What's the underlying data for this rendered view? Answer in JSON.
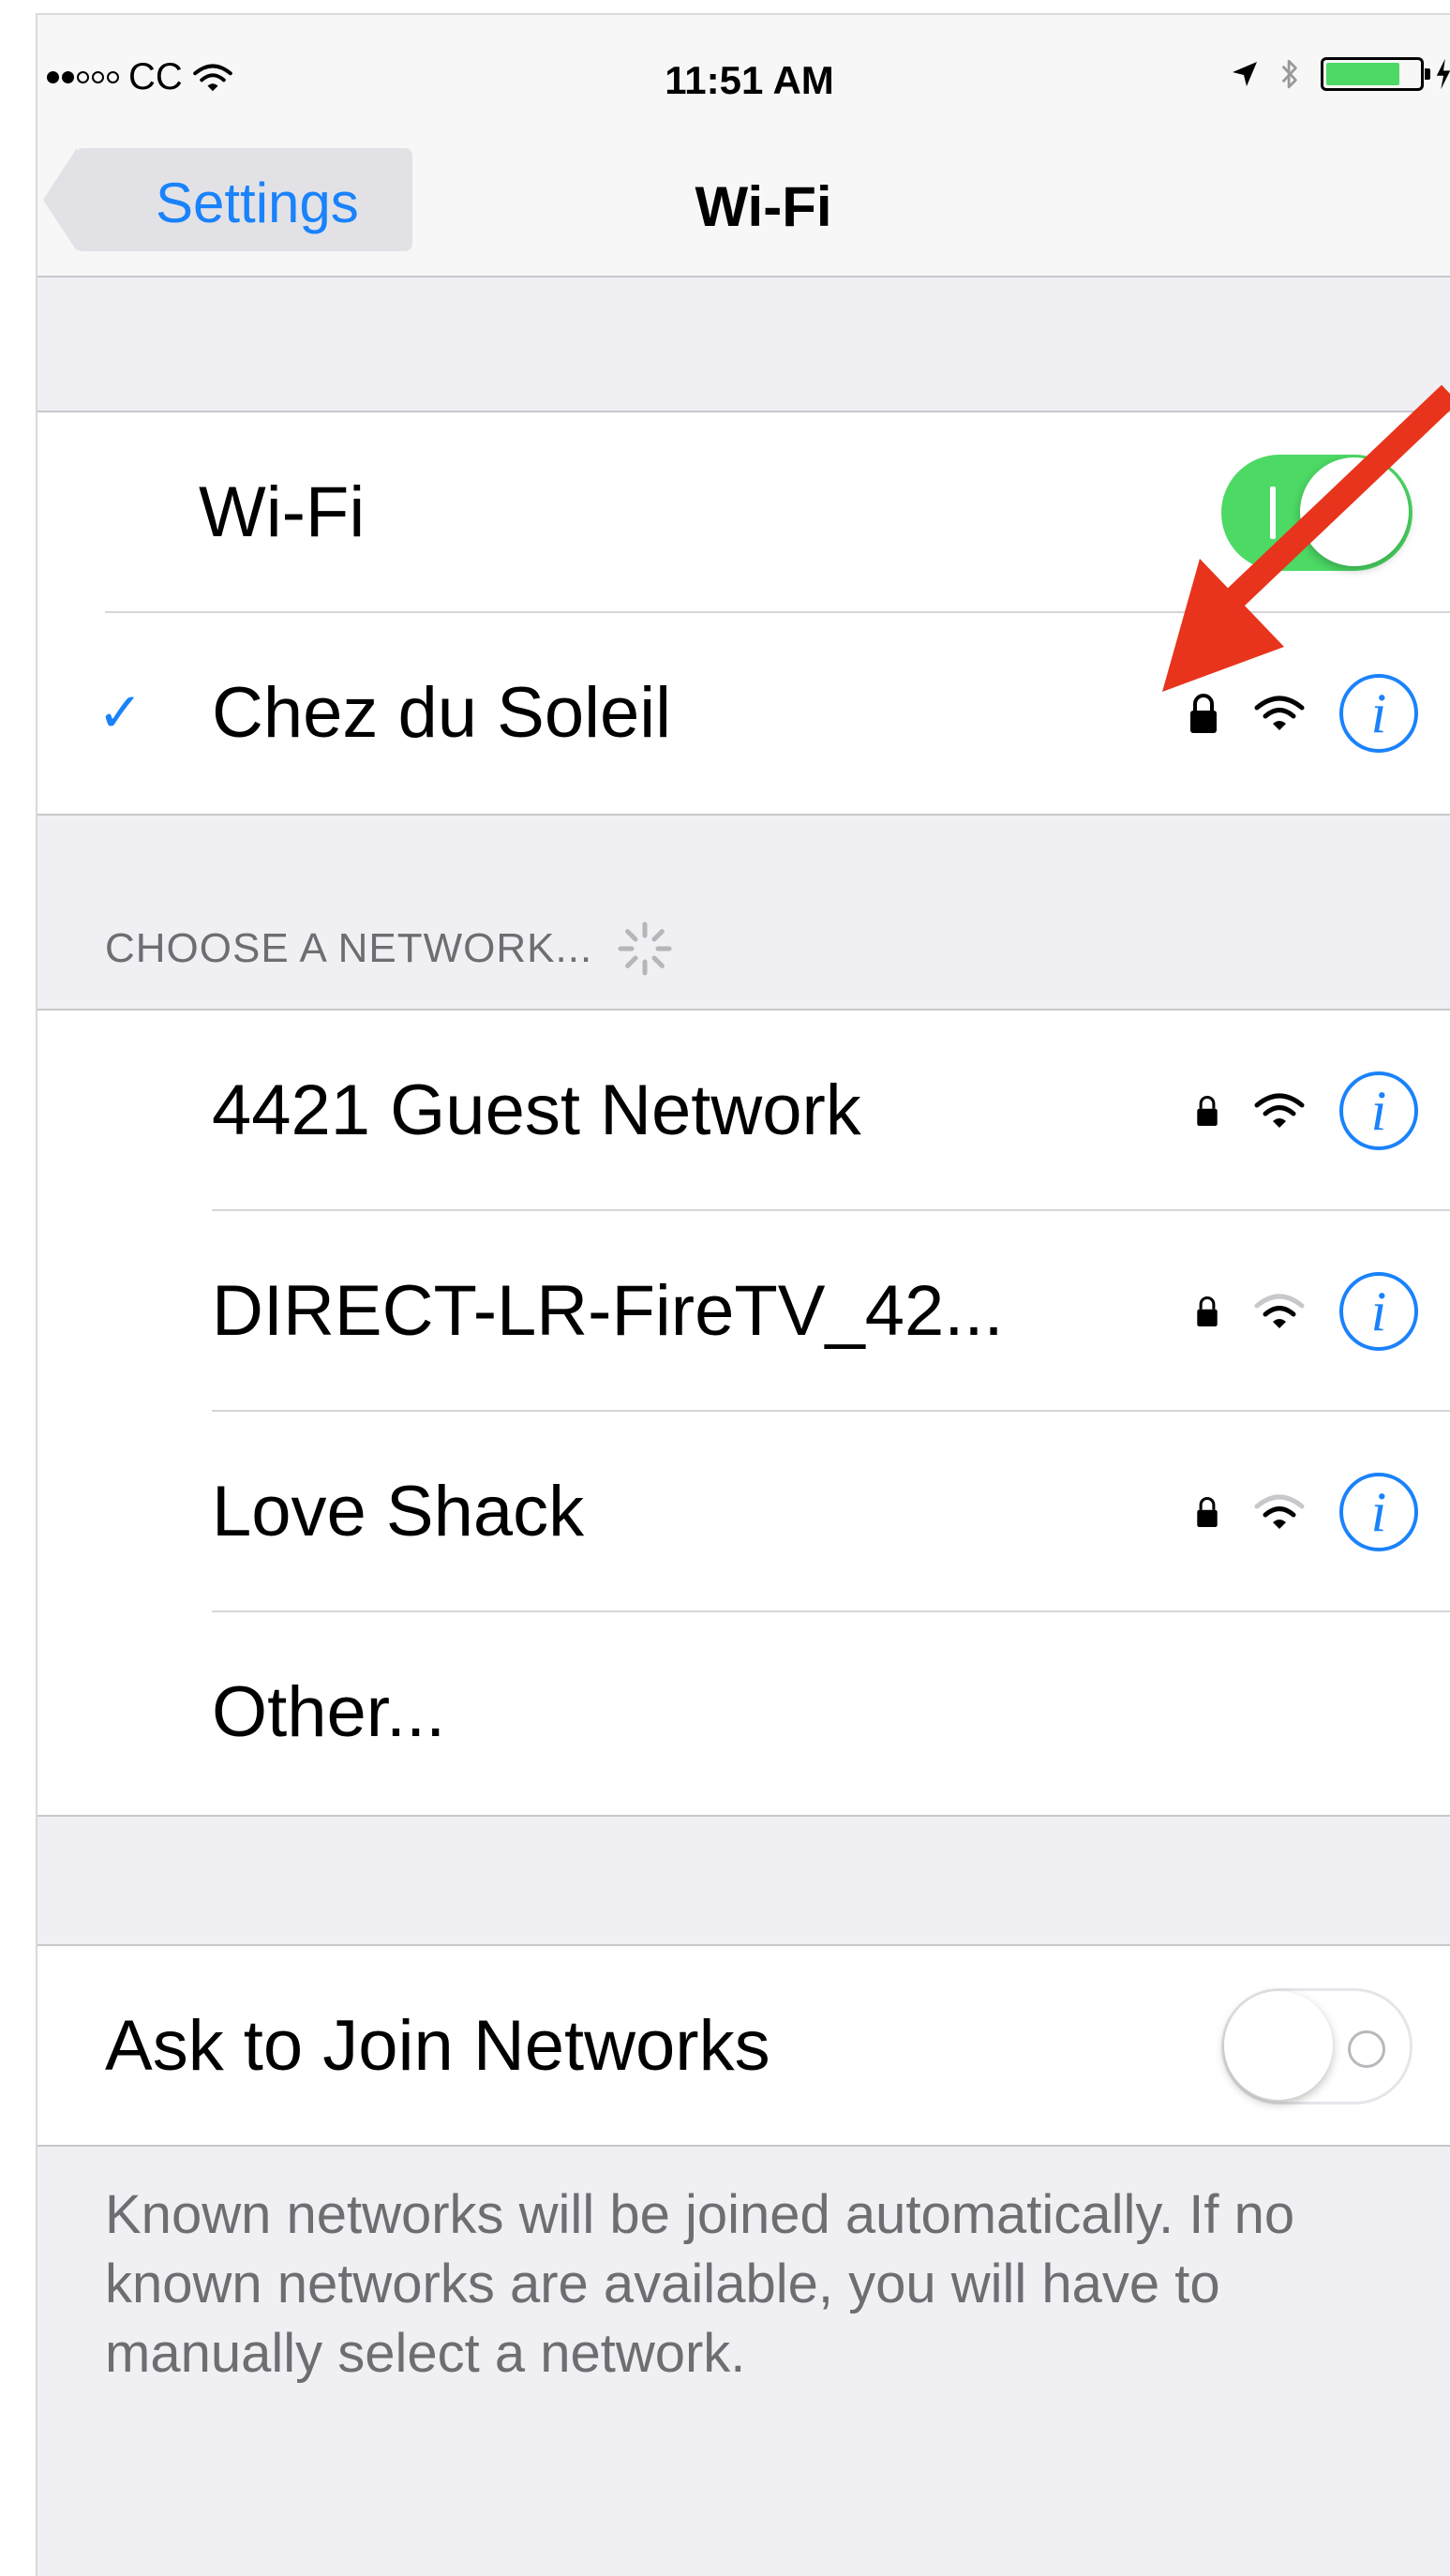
{
  "status_bar": {
    "carrier": "CC",
    "time": "11:51 AM",
    "signal_bars_filled": 2,
    "signal_bars_total": 5,
    "battery_level": 0.8
  },
  "nav": {
    "back_label": "Settings",
    "title": "Wi-Fi"
  },
  "wifi_toggle": {
    "label": "Wi-Fi",
    "state": "on"
  },
  "connected_network": {
    "name": "Chez du Soleil",
    "secured": true,
    "signal": "full"
  },
  "choose_section": {
    "header": "CHOOSE A NETWORK..."
  },
  "networks": [
    {
      "name": "4421 Guest Network",
      "secured": true,
      "signal": "full"
    },
    {
      "name": "DIRECT-LR-FireTV_42...",
      "secured": true,
      "signal": "medium"
    },
    {
      "name": "Love Shack",
      "secured": true,
      "signal": "medium"
    }
  ],
  "other_label": "Other...",
  "ask_to_join": {
    "label": "Ask to Join Networks",
    "state": "off",
    "description": "Known networks will be joined automatically. If no known networks are available, you will have to manually select a network."
  },
  "colors": {
    "accent": "#1a82fb",
    "toggle_on": "#4cd964",
    "annotation_arrow": "#e8341c"
  }
}
